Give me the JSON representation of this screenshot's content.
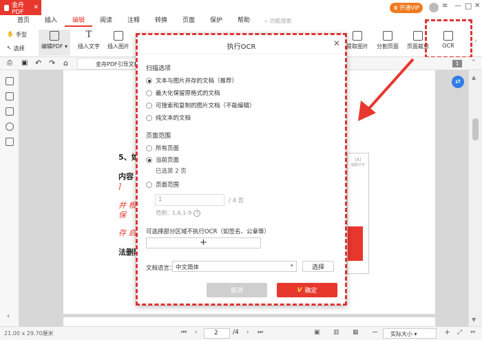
{
  "app": {
    "tab_label": "金舟PDF",
    "vip_label": "开通VIP",
    "window_controls": [
      "—",
      "□",
      "✕"
    ]
  },
  "menu": [
    "首页",
    "插入",
    "编辑",
    "阅读",
    "注释",
    "转换",
    "页面",
    "保护",
    "帮助"
  ],
  "menu_active": "编辑",
  "menu_search": "功能搜索",
  "toolbar": {
    "hand": "手型",
    "select": "选择",
    "edit_pdf": "编辑PDF",
    "insert_text": "插入文字",
    "insert_image": "插入图片",
    "extract_image": "提取图片",
    "split_page": "分割页面",
    "page_crop": "页面裁剪",
    "ocr": "OCR"
  },
  "doc_tab": "金舟PDF引导文档",
  "page_badge": "1",
  "page_text": {
    "l1": "5、如",
    "l2": "内容",
    "l3": "]",
    "l4": "并 根",
    "l5": "保",
    "l6": "存 启",
    "l7": "法删除",
    "side_label": "提取文字"
  },
  "dialog": {
    "title": "执行OCR",
    "scan_title": "扫描选项",
    "scan_options": [
      "文本与图片并存的文档（推荐）",
      "最大化保留原格式的文档",
      "可搜索和复制的图片文档（不能编辑）",
      "纯文本的文档"
    ],
    "scan_selected": 0,
    "range_title": "页面范围",
    "range_options": [
      "所有页面",
      "当前页面",
      "页面范围"
    ],
    "range_selected": 1,
    "selected_page_note": "已选第 2 页",
    "range_value": "1",
    "range_total": "/ 4 页",
    "range_example": "范例：1,6,1-9",
    "region_label": "可选择部分区域不执行OCR（如签名、公章等）",
    "lang_label": "文档语言：",
    "lang_value": "中文简体",
    "choose_label": "选择",
    "cancel_label": "取消",
    "ok_label": "确定"
  },
  "status": {
    "size": "21.00 x 29.70厘米",
    "page_current": "2",
    "page_total": "/4",
    "zoom": "实际大小"
  },
  "colors": {
    "accent": "#e8372c",
    "highlight": "#dd3333",
    "vip": "#f07a1e"
  }
}
